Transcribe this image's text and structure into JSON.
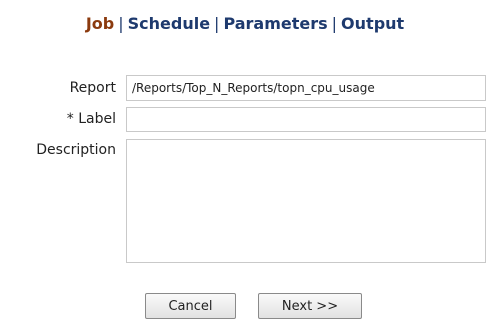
{
  "tabs": {
    "job": "Job",
    "schedule": "Schedule",
    "parameters": "Parameters",
    "output": "Output",
    "separator": "|"
  },
  "form": {
    "report_label": "Report",
    "report_value": "/Reports/Top_N_Reports/topn_cpu_usage",
    "label_label": "* Label",
    "label_value": "",
    "description_label": "Description",
    "description_value": ""
  },
  "buttons": {
    "cancel": "Cancel",
    "next": "Next >>"
  },
  "colors": {
    "active_tab": "#8b3a0e",
    "tab": "#1e3a6e"
  }
}
